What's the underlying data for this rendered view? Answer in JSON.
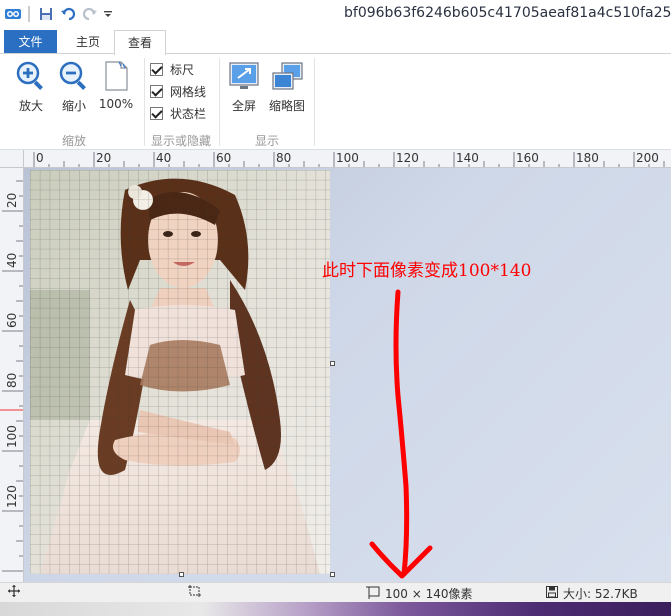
{
  "window": {
    "title": "bf096b63f6246b605c41705aeaf81a4c510fa25"
  },
  "tabs": [
    {
      "label": "文件"
    },
    {
      "label": "主页"
    },
    {
      "label": "查看"
    }
  ],
  "ribbon": {
    "zoom_in": "放大",
    "zoom_out": "缩小",
    "actual_size": "100%",
    "zoom_group": "缩放",
    "ruler": "标尺",
    "gridlines": "网格线",
    "statusbar": "状态栏",
    "show_hide_group": "显示或隐藏",
    "fullscreen": "全屏",
    "thumbnail": "缩略图",
    "display_group": "显示"
  },
  "rulers": {
    "horizontal": [
      "0",
      "20",
      "40",
      "60",
      "80",
      "100",
      "120",
      "140",
      "160",
      "180",
      "200"
    ],
    "vertical": [
      "20",
      "40",
      "60",
      "80",
      "100",
      "120"
    ]
  },
  "annotation": {
    "text": "此时下面像素变成100*140",
    "color": "#ff0000"
  },
  "status": {
    "dimensions": "100 × 140像素",
    "size": "大小: 52.7KB"
  },
  "colors": {
    "file_tab": "#2b6fc2",
    "annotation": "#ff0000"
  }
}
